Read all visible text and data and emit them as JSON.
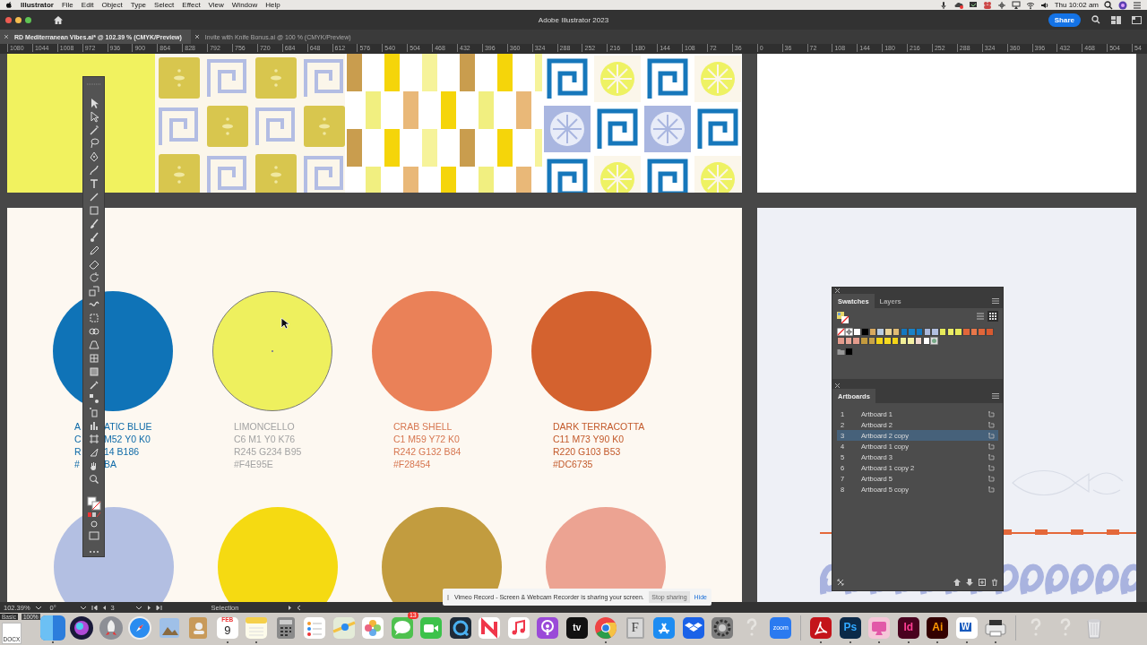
{
  "menu_bar": {
    "app": "Illustrator",
    "menus": [
      "File",
      "Edit",
      "Object",
      "Type",
      "Select",
      "Effect",
      "View",
      "Window",
      "Help"
    ],
    "clock": "Thu 10:02 am"
  },
  "window": {
    "title": "Adobe Illustrator 2023",
    "share": "Share"
  },
  "documents": [
    {
      "label": "RD Mediterranean Vibes.ai* @ 102.39 % (CMYK/Preview)",
      "selected": true
    },
    {
      "label": "Invite with Knife Bonus.ai @ 100 % (CMYK/Preview)",
      "selected": false
    }
  ],
  "ruler": [
    "1080",
    "1044",
    "1008",
    "972",
    "936",
    "900",
    "864",
    "828",
    "792",
    "756",
    "720",
    "684",
    "648",
    "612",
    "576",
    "540",
    "504",
    "468",
    "432",
    "396",
    "360",
    "324",
    "288",
    "252",
    "216",
    "180",
    "144",
    "108",
    "72",
    "36",
    "0",
    "36",
    "72",
    "108",
    "144",
    "180",
    "216",
    "252",
    "288",
    "324",
    "360",
    "396",
    "432",
    "468",
    "504",
    "54"
  ],
  "swatch_cards": [
    {
      "lines": [
        [
          "A",
          "ATIC BLUE"
        ],
        [
          "C",
          "M52 Y0 K0"
        ],
        [
          "R",
          "14 B186"
        ],
        [
          "#",
          "BA"
        ]
      ],
      "color": "#0f73b7",
      "selected": false
    },
    {
      "lines": [
        [
          "LIMONCELLO"
        ],
        [
          "C6 M1 Y0 K76"
        ],
        [
          "R245 G234 B95"
        ],
        [
          "#F4E95E"
        ]
      ],
      "color": "#eef05e",
      "selected": true
    },
    {
      "lines": [
        [
          "CRAB SHELL"
        ],
        [
          "C1 M59 Y72 K0"
        ],
        [
          "R242 G132 B84"
        ],
        [
          "#F28454"
        ]
      ],
      "color": "#ea8158",
      "selected": false
    },
    {
      "lines": [
        [
          "DARK TERRACOTTA"
        ],
        [
          "C11 M73 Y90 K0"
        ],
        [
          "R220 G103 B53"
        ],
        [
          "#DC6735"
        ]
      ],
      "color": "#d4622f",
      "selected": false
    }
  ],
  "lower_circles": [
    {
      "color": "#b3bfe2"
    },
    {
      "color": "#f5da12"
    },
    {
      "color": "#c29c3f"
    },
    {
      "color": "#eca392"
    }
  ],
  "swatches_panel": {
    "tabs": [
      {
        "label": "Swatches",
        "selected": true
      },
      {
        "label": "Layers",
        "selected": false
      }
    ],
    "views": [
      {
        "kind": "list",
        "selected": false
      },
      {
        "kind": "grid",
        "selected": true
      }
    ],
    "rows": [
      [
        {
          "kind": "none"
        },
        {
          "kind": "registration"
        },
        {
          "kind": "color",
          "color": "#ffffff"
        },
        {
          "kind": "color",
          "color": "#000000"
        },
        {
          "kind": "color",
          "color": "#d9a95e"
        },
        {
          "kind": "color",
          "color": "#b9cbe0"
        },
        {
          "kind": "color",
          "color": "#ead395"
        },
        {
          "kind": "color",
          "color": "#e0bc74"
        },
        {
          "kind": "color",
          "color": "#1478c0"
        },
        {
          "kind": "color",
          "color": "#1a82c6"
        },
        {
          "kind": "color",
          "color": "#1478c0"
        },
        {
          "kind": "color",
          "color": "#aab8dc"
        },
        {
          "kind": "color",
          "color": "#b2bfe0"
        },
        {
          "kind": "color",
          "color": "#e6ea5a"
        },
        {
          "kind": "color",
          "color": "#ecee66"
        },
        {
          "kind": "color",
          "color": "#e6ea5a"
        },
        {
          "kind": "color",
          "color": "#e0663a"
        },
        {
          "kind": "color",
          "color": "#e8774a"
        },
        {
          "kind": "color",
          "color": "#e0663a"
        },
        {
          "kind": "color",
          "color": "#d85a30"
        }
      ],
      [
        {
          "kind": "color",
          "color": "#e39b8c"
        },
        {
          "kind": "color",
          "color": "#e7a597"
        },
        {
          "kind": "color",
          "color": "#e39b8c"
        },
        {
          "kind": "color",
          "color": "#c39a3e"
        },
        {
          "kind": "color",
          "color": "#c8a247"
        },
        {
          "kind": "color",
          "color": "#f3d418"
        },
        {
          "kind": "color",
          "color": "#f5da20"
        },
        {
          "kind": "color",
          "color": "#f3d418"
        },
        {
          "kind": "color",
          "color": "#f1ee98"
        },
        {
          "kind": "color",
          "color": "#f4f0a4"
        },
        {
          "kind": "color",
          "color": "#f0d8cf"
        },
        {
          "kind": "color",
          "color": "#ffffff"
        },
        {
          "kind": "image"
        }
      ],
      [
        {
          "kind": "folder"
        },
        {
          "kind": "color",
          "color": "#000000"
        }
      ]
    ]
  },
  "artboards_panel": {
    "title": "Artboards",
    "items": [
      {
        "number": "1",
        "name": "Artboard 1",
        "selected": false
      },
      {
        "number": "2",
        "name": "Artboard 2",
        "selected": false
      },
      {
        "number": "3",
        "name": "Artboard 2 copy",
        "selected": true
      },
      {
        "number": "4",
        "name": "Artboard 1 copy",
        "selected": false
      },
      {
        "number": "5",
        "name": "Artboard 3",
        "selected": false
      },
      {
        "number": "6",
        "name": "Artboard 1 copy 2",
        "selected": false
      },
      {
        "number": "7",
        "name": "Artboard 5",
        "selected": false
      },
      {
        "number": "8",
        "name": "Artboard 5 copy",
        "selected": false
      }
    ]
  },
  "status_bar": {
    "zoom": "102.39%",
    "rotation": "0°",
    "artboard": "3",
    "tool": "Selection"
  },
  "overlay_labels": [
    "Basic",
    "100%"
  ],
  "desktop_file": "DOCX",
  "notification": {
    "message": "Vimeo Record - Screen & Webcam Recorder is sharing your screen.",
    "stop": "Stop sharing",
    "hide": "Hide"
  },
  "dock": [
    [
      {
        "kind": "finder",
        "running": true
      },
      {
        "kind": "siri",
        "running": false
      },
      {
        "kind": "launchpad",
        "running": false
      },
      {
        "kind": "safari",
        "running": false
      },
      {
        "kind": "preview",
        "running": false
      },
      {
        "kind": "contacts",
        "running": false
      },
      {
        "kind": "calendar",
        "texts": [
          "FEB",
          "9"
        ],
        "running": true
      },
      {
        "kind": "notes",
        "running": true
      },
      {
        "kind": "calculator",
        "running": false
      },
      {
        "kind": "reminders",
        "running": false
      },
      {
        "kind": "maps",
        "running": false
      },
      {
        "kind": "photos",
        "running": false
      },
      {
        "kind": "messages",
        "badge": "13",
        "running": false
      },
      {
        "kind": "facetime",
        "running": false
      },
      {
        "kind": "quicktime",
        "running": false
      },
      {
        "kind": "news",
        "running": false
      },
      {
        "kind": "music",
        "running": false
      },
      {
        "kind": "podcasts",
        "running": false
      },
      {
        "kind": "tv",
        "texts": [
          "tv"
        ],
        "running": false
      },
      {
        "kind": "chrome",
        "running": true
      },
      {
        "kind": "fontbook",
        "texts": [
          "F"
        ],
        "running": false
      },
      {
        "kind": "appstore",
        "running": false
      },
      {
        "kind": "dropbox",
        "running": false
      },
      {
        "kind": "settings",
        "running": false
      },
      {
        "kind": "unknown",
        "running": false
      },
      {
        "kind": "zoom",
        "texts": [
          "zoom"
        ],
        "running": false
      }
    ],
    [
      {
        "kind": "acrobat",
        "running": true
      },
      {
        "kind": "photoshop",
        "texts": [
          "Ps"
        ],
        "running": true
      },
      {
        "kind": "cleaner",
        "running": true
      },
      {
        "kind": "indesign",
        "texts": [
          "Id"
        ],
        "running": true
      },
      {
        "kind": "illustrator",
        "texts": [
          "Ai"
        ],
        "running": true
      },
      {
        "kind": "word",
        "texts": [
          "W"
        ],
        "running": true
      },
      {
        "kind": "printer",
        "running": true
      }
    ],
    [
      {
        "kind": "unknown",
        "running": false
      },
      {
        "kind": "unknown",
        "running": false
      },
      {
        "kind": "trash",
        "running": false
      }
    ]
  ]
}
